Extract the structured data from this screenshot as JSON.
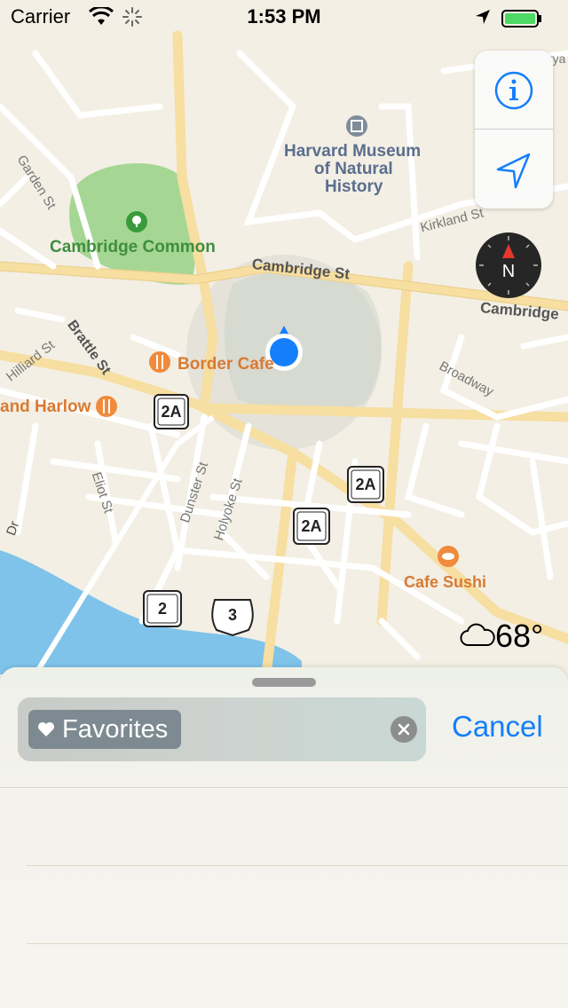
{
  "status_bar": {
    "carrier": "Carrier",
    "time": "1:53 PM"
  },
  "map": {
    "labels": {
      "museum_line1": "Harvard Museum",
      "museum_line2": "of Natural",
      "museum_line3": "History",
      "cambridge_common": "Cambridge Common",
      "cambridge_st": "Cambridge St",
      "cambridge_st_right": "Cambridge",
      "kirkland_st": "Kirkland St",
      "garden_st": "Garden St",
      "brattle_st": "Brattle St",
      "hilliard_st": "Hilliard St",
      "border_cafe": "Border Cafe",
      "harlow": "and Harlow",
      "broadway": "Broadway",
      "dunster_st": "Dunster St",
      "holyoke_st": "Holyoke St",
      "eliot_st": "Eliot St",
      "cafe_sushi": "Cafe Sushi",
      "dr": "Dr",
      "corner_road": "rya"
    },
    "shields": {
      "route_2a_a": "2A",
      "route_2a_b": "2A",
      "route_2a_c": "2A",
      "route_2": "2",
      "route_3": "3"
    },
    "compass_letter": "N",
    "weather": "68°"
  },
  "sheet": {
    "search_token": "Favorites",
    "cancel_label": "Cancel"
  },
  "colors": {
    "accent": "#157efb",
    "map_bg": "#f3efe4",
    "park": "#a6d694",
    "water": "#7fc3ea",
    "major_road": "#f7dea1"
  }
}
